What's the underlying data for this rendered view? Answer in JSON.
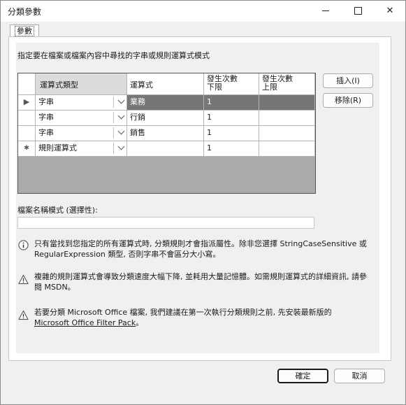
{
  "window": {
    "title": "分類參數"
  },
  "tab": {
    "label": "參數"
  },
  "description": "指定要在檔案或檔案內容中尋找的字串或規則運算式模式",
  "grid": {
    "headers": {
      "type": "運算式類型",
      "expression": "運算式",
      "min": "發生次數\n下限",
      "max": "發生次數\n上限"
    },
    "rows": [
      {
        "marker": "▶",
        "type": "字串",
        "expression": "業務",
        "min": "1",
        "max": ""
      },
      {
        "marker": "",
        "type": "字串",
        "expression": "行銷",
        "min": "1",
        "max": ""
      },
      {
        "marker": "",
        "type": "字串",
        "expression": "銷售",
        "min": "1",
        "max": ""
      },
      {
        "marker": "✱",
        "type": "規則運算式",
        "expression": "",
        "min": "1",
        "max": ""
      }
    ]
  },
  "buttons": {
    "insert": "插入(I)",
    "remove": "移除(R)",
    "ok": "確定",
    "cancel": "取消"
  },
  "filename_label": "檔案名稱模式 (選擇性):",
  "filename_value": "",
  "notes": {
    "info": "只有當找到您指定的所有運算式時, 分類規則才會指派屬性。除非您選擇 StringCaseSensitive 或 RegularExpression 類型, 否則字串不會區分大小寫。",
    "warning1": "複雜的規則運算式會導致分類速度大幅下降, 並耗用大量記憶體。如需規則運算式的詳細資訊, 請參閱 MSDN。",
    "warning2_text": "若要分類 Microsoft Office 檔案, 我們建議在第一次執行分類規則之前, 先安裝最新版的",
    "warning2_link": "Microsoft Office Filter Pack",
    "warning2_end": "。"
  }
}
